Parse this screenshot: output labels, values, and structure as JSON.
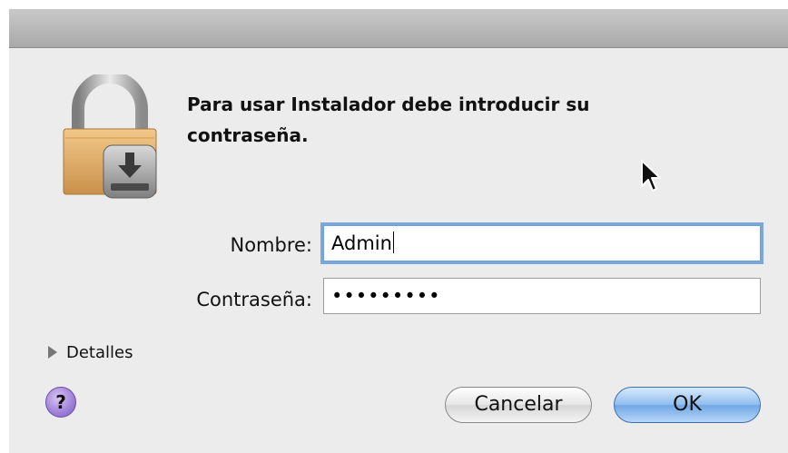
{
  "dialog": {
    "message": "Para usar Instalador debe introducir su contraseña."
  },
  "form": {
    "name_label": "Nombre:",
    "name_value": "Admin",
    "password_label": "Contraseña:",
    "password_value": "•••••••••"
  },
  "details": {
    "label": "Detalles"
  },
  "help": {
    "label": "?"
  },
  "buttons": {
    "cancel": "Cancelar",
    "ok": "OK"
  },
  "icons": {
    "lock": "padlock-installer-icon",
    "disclosure": "disclosure-triangle-icon",
    "help": "help-icon",
    "cursor": "mouse-pointer-icon"
  },
  "colors": {
    "dialog_bg": "#ececec",
    "focus_ring": "#7aa7de",
    "default_button": "#6fa7e6"
  }
}
